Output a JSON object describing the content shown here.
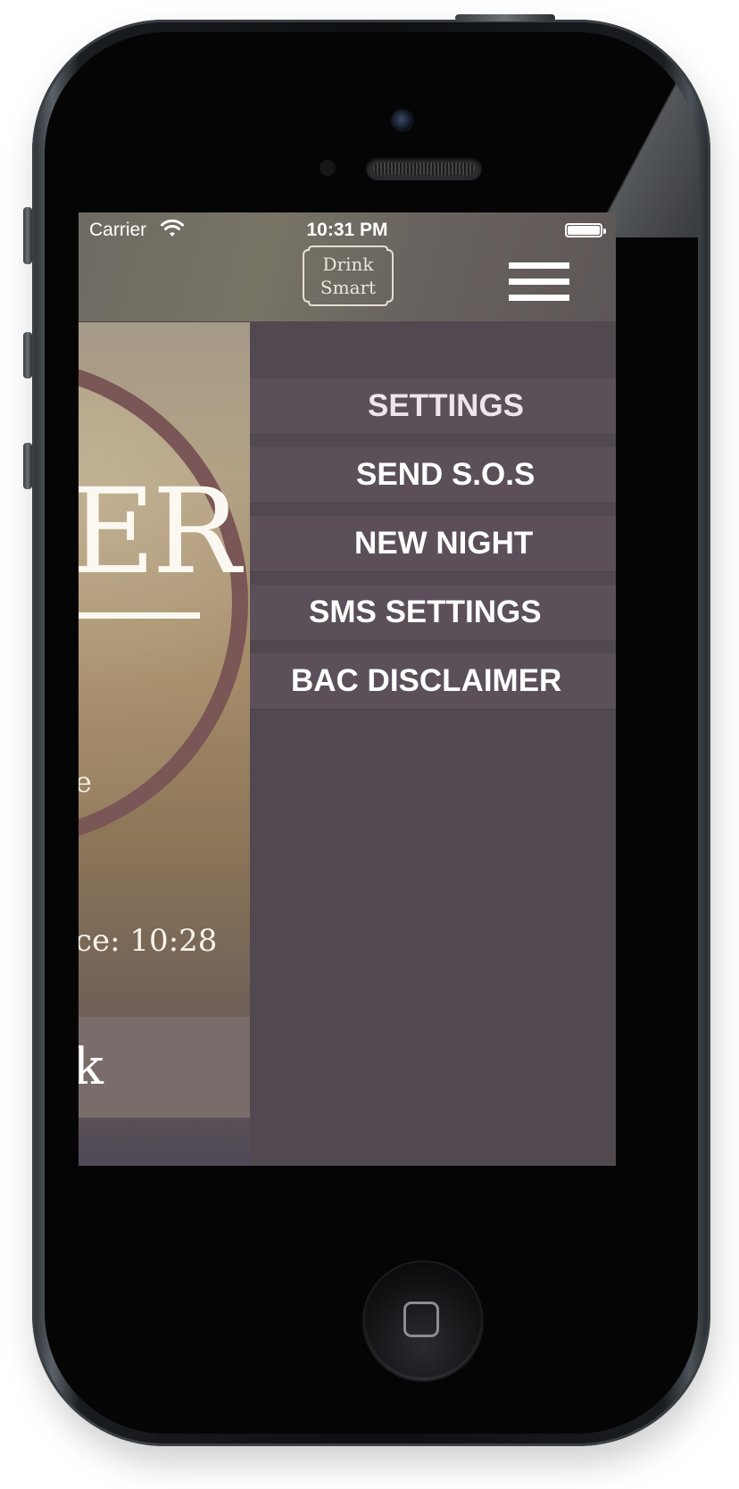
{
  "status_bar": {
    "carrier": "Carrier",
    "time": "10:31 PM"
  },
  "header": {
    "logo_line1": "Drink",
    "logo_line2": "Smart",
    "menu_icon": "hamburger-menu-icon"
  },
  "main": {
    "title_fragment": "ER",
    "label_fragment": "e",
    "since_text": "ce: 10:28",
    "button_fragment": "k"
  },
  "menu": {
    "items": [
      {
        "label": "SETTINGS"
      },
      {
        "label": "SEND S.O.S"
      },
      {
        "label": "NEW NIGHT"
      },
      {
        "label": "SMS SETTINGS"
      },
      {
        "label": "BAC DISCLAIMER"
      }
    ]
  },
  "colors": {
    "menu_background": "#524850",
    "menu_item_background": "#5b5059",
    "ring": "#7b5656",
    "navbar": "#6e6a62"
  }
}
